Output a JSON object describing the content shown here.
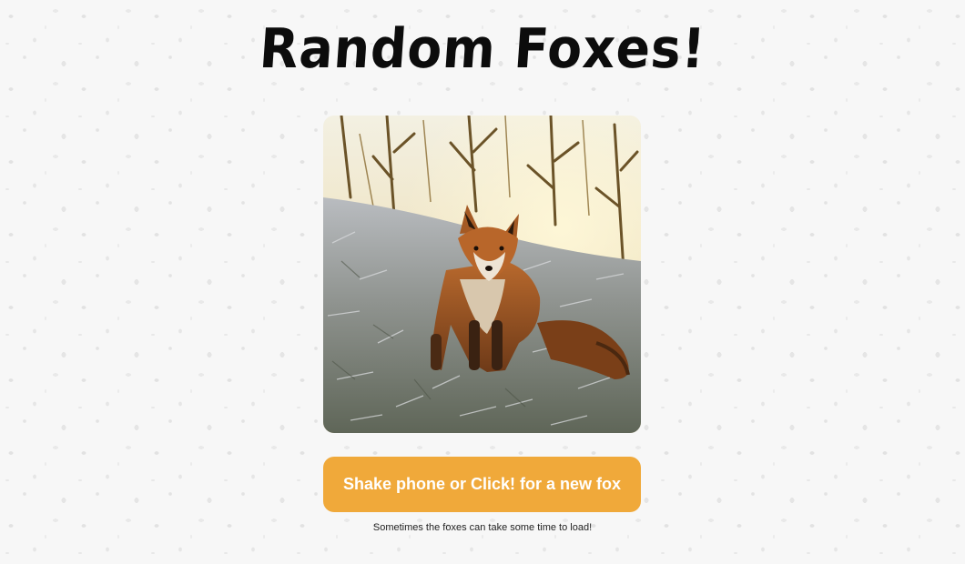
{
  "page": {
    "title": "Random Foxes!"
  },
  "image": {
    "subject": "fox sitting in frosty grass",
    "alt": "Random fox"
  },
  "button": {
    "label": "Shake phone or Click! for a new fox"
  },
  "note": {
    "text": "Sometimes the foxes can take some time to load!"
  },
  "colors": {
    "accent": "#f0a93a",
    "button_text": "#ffffff",
    "title": "#0c0c0c",
    "background": "#f7f7f7"
  }
}
